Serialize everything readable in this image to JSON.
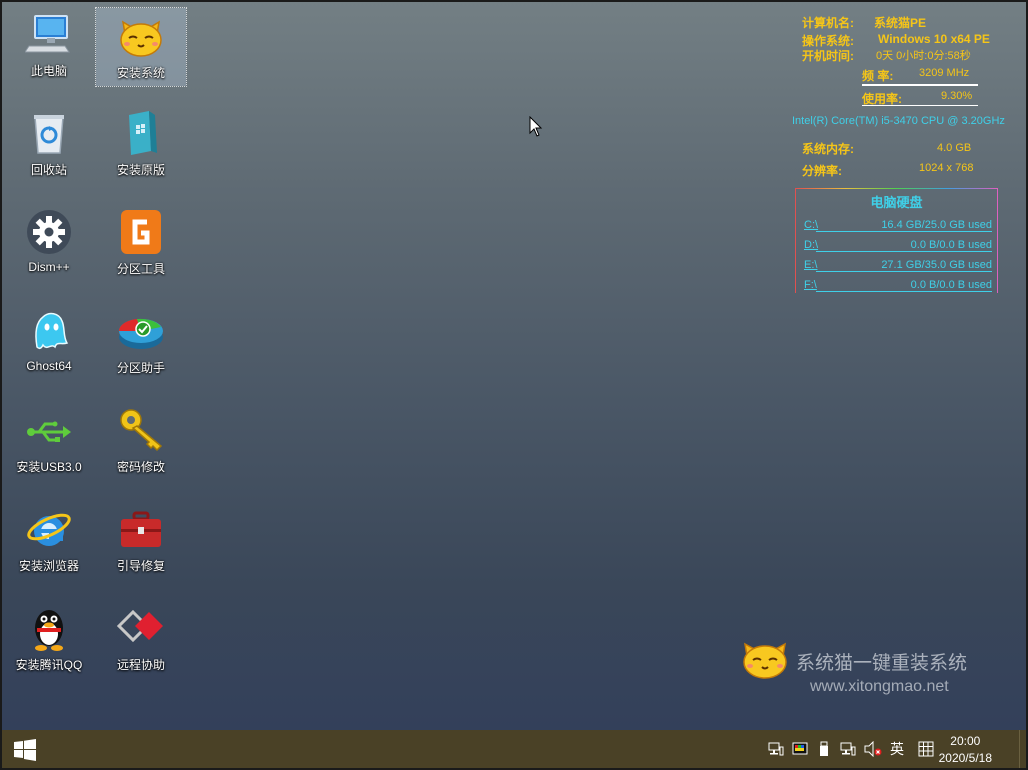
{
  "desktop_icons": [
    {
      "label": "此电脑",
      "icon": "computer-icon"
    },
    {
      "label": "安装系统",
      "icon": "cat-face-icon"
    },
    {
      "label": "回收站",
      "icon": "recycle-bin-icon"
    },
    {
      "label": "安装原版",
      "icon": "windows-box-icon"
    },
    {
      "label": "Dism++",
      "icon": "gear-icon"
    },
    {
      "label": "分区工具",
      "icon": "diskgenius-icon"
    },
    {
      "label": "Ghost64",
      "icon": "ghost-icon"
    },
    {
      "label": "分区助手",
      "icon": "partition-pie-icon"
    },
    {
      "label": "安装USB3.0",
      "icon": "usb-icon"
    },
    {
      "label": "密码修改",
      "icon": "key-icon"
    },
    {
      "label": "安装浏览器",
      "icon": "ie-icon"
    },
    {
      "label": "引导修复",
      "icon": "toolbox-icon"
    },
    {
      "label": "安装腾讯QQ",
      "icon": "qq-penguin-icon"
    },
    {
      "label": "远程协助",
      "icon": "remote-diamond-icon"
    }
  ],
  "sysinfo": {
    "computer_name_label": "计算机名:",
    "computer_name": "系统猫PE",
    "os_label": "操作系统:",
    "os": "Windows 10 x64 PE",
    "uptime_label": "开机时间:",
    "uptime": "0天 0小时:0分:58秒",
    "freq_label": "频  率:",
    "freq": "3209 MHz",
    "usage_label": "使用率:",
    "usage": "9.30%",
    "cpu": "Intel(R) Core(TM) i5-3470 CPU @ 3.20GHz",
    "memory_label": "系统内存:",
    "memory": "4.0 GB",
    "resolution_label": "分辨率:",
    "resolution": "1024 x 768",
    "disk_title": "电脑硬盘",
    "disks": [
      {
        "drive": "C:\\",
        "usage": "16.4 GB/25.0 GB used"
      },
      {
        "drive": "D:\\",
        "usage": "0.0 B/0.0 B used"
      },
      {
        "drive": "E:\\",
        "usage": "27.1 GB/35.0 GB used"
      },
      {
        "drive": "F:\\",
        "usage": "0.0 B/0.0 B used"
      }
    ]
  },
  "watermark": {
    "text": "系统猫一键重装系统",
    "url": "www.xitongmao.net"
  },
  "taskbar": {
    "ime": "英",
    "time": "20:00",
    "date": "2020/5/18"
  },
  "colors": {
    "info_gold": "#f5c518",
    "info_cyan": "#3fd0e8",
    "taskbar": "#4a4126"
  }
}
